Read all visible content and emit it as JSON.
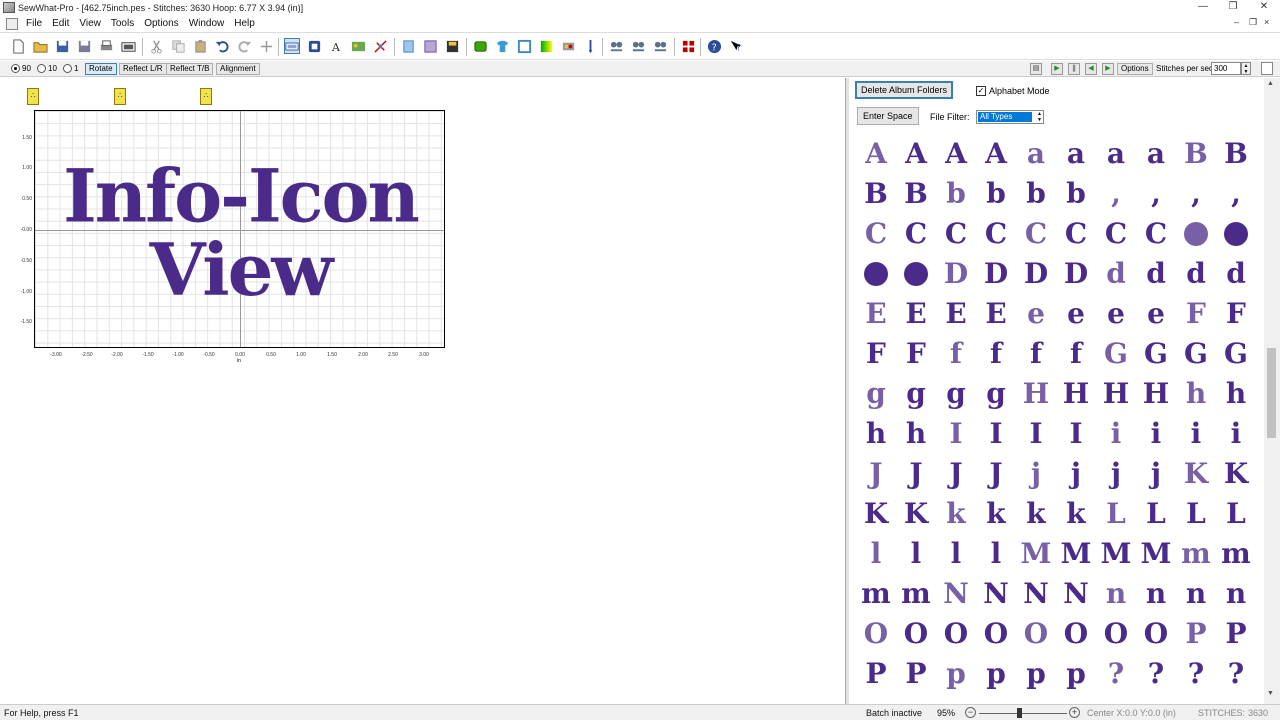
{
  "window": {
    "title": "SewWhat-Pro - [462.75inch.pes - Stitches: 3630  Hoop: 6.77 X 3.94 (in)]",
    "minimize": "—",
    "restore": "❐",
    "close": "✕",
    "mdi_minimize": "–",
    "mdi_restore": "❐",
    "mdi_close": "×"
  },
  "menu": [
    "File",
    "Edit",
    "View",
    "Tools",
    "Options",
    "Window",
    "Help"
  ],
  "subbar": {
    "radios": [
      "90",
      "10",
      "1"
    ],
    "buttons": [
      "Rotate",
      "Reflect L/R",
      "Reflect T/B",
      "Alignment"
    ],
    "options_label": "Options",
    "stitches_label": "Stitches per sec",
    "stitches_value": "300"
  },
  "design": {
    "line1": "Info-Icon",
    "line2": "View",
    "yticks": [
      "1.50",
      "1.00",
      "0.50",
      "-0.00",
      "-0.50",
      "-1.00",
      "-1.50"
    ],
    "xticks": [
      "-3.00",
      "-2.50",
      "-2.00",
      "-1.50",
      "-1.00",
      "-0.50",
      "0.00",
      "0.50",
      "1.00",
      "1.50",
      "2.00",
      "2.50",
      "3.00"
    ],
    "x_unit": "in",
    "marker_glyph": "∴"
  },
  "panel": {
    "delete_album": "Delete Album Folders",
    "alphabet_mode": "Alphabet Mode",
    "alphabet_checked": "✓",
    "enter_space": "Enter Space",
    "file_filter_label": "File Filter:",
    "file_filter_value": "All Types",
    "glyphs": [
      "A",
      "A",
      "A",
      "A",
      "a",
      "a",
      "a",
      "a",
      "B",
      "B",
      "B",
      "B",
      "b",
      "b",
      "b",
      "b",
      ",",
      ",",
      ",",
      ",",
      "C",
      "C",
      "C",
      "C",
      "C",
      "C",
      "C",
      "C",
      "•",
      "•",
      "•",
      "•",
      "D",
      "D",
      "D",
      "D",
      "d",
      "d",
      "d",
      "d",
      "E",
      "E",
      "E",
      "E",
      "e",
      "e",
      "e",
      "e",
      "F",
      "F",
      "F",
      "F",
      "f",
      "f",
      "f",
      "f",
      "G",
      "G",
      "G",
      "G",
      "g",
      "g",
      "g",
      "g",
      "H",
      "H",
      "H",
      "H",
      "h",
      "h",
      "h",
      "h",
      "I",
      "I",
      "I",
      "I",
      "i",
      "i",
      "i",
      "i",
      "J",
      "J",
      "J",
      "J",
      "j",
      "j",
      "j",
      "j",
      "K",
      "K",
      "K",
      "K",
      "k",
      "k",
      "k",
      "k",
      "L",
      "L",
      "L",
      "L",
      "l",
      "l",
      "l",
      "l",
      "M",
      "M",
      "M",
      "M",
      "m",
      "m",
      "m",
      "m",
      "N",
      "N",
      "N",
      "N",
      "n",
      "n",
      "n",
      "n",
      "O",
      "O",
      "O",
      "O",
      "O",
      "O",
      "O",
      "O",
      "P",
      "P",
      "P",
      "P",
      "p",
      "p",
      "p",
      "p",
      "?",
      "?",
      "?",
      "?"
    ]
  },
  "status": {
    "help": "For Help, press F1",
    "batch": "Batch inactive",
    "zoom": "95%",
    "center": "Center X:0.0  Y:0.0 (in)",
    "stitches_label": "STITCHES:",
    "stitches_value": "3630"
  },
  "colors": {
    "thread": "#4b2b8a",
    "marker": "#f2e24b",
    "selection": "#0078d7"
  }
}
